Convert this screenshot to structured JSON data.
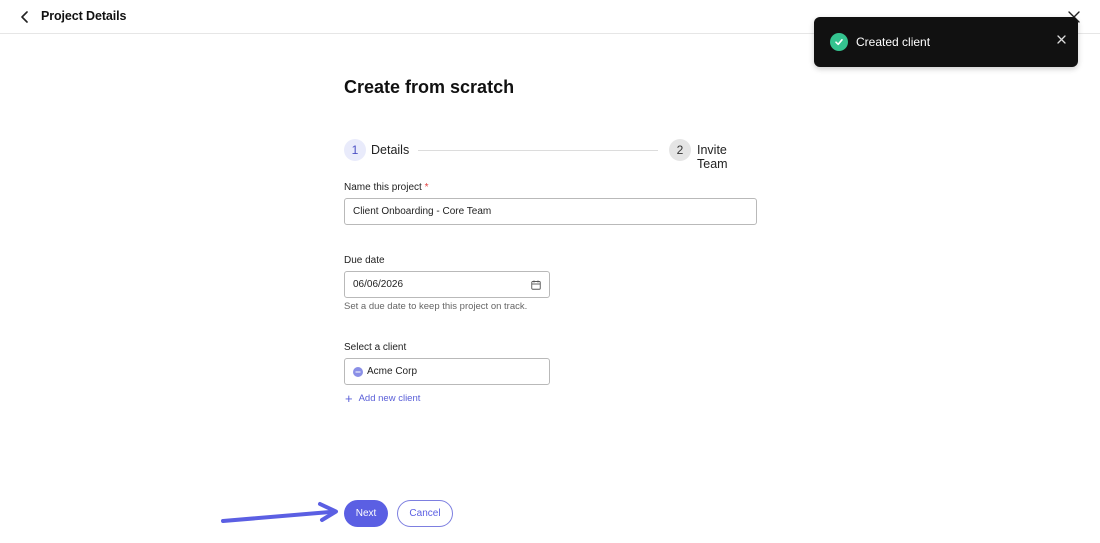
{
  "header": {
    "title": "Project Details",
    "back_icon": "chevron-left-icon",
    "close_icon": "close-icon"
  },
  "toast": {
    "message": "Created client",
    "icon": "check-circle-icon",
    "icon_color": "#34c38f"
  },
  "main": {
    "heading": "Create from scratch",
    "steps": [
      {
        "number": "1",
        "label": "Details"
      },
      {
        "number": "2",
        "label": "Invite Team"
      }
    ],
    "project_name": {
      "label": "Name this project",
      "required_marker": "*",
      "value": "Client Onboarding - Core Team"
    },
    "due_date": {
      "label": "Due date",
      "value": "06/06/2026",
      "helper": "Set a due date to keep this project on track."
    },
    "client": {
      "label": "Select a client",
      "value": "Acme Corp"
    },
    "add_client_label": "Add new client"
  },
  "actions": {
    "next_label": "Next",
    "cancel_label": "Cancel"
  },
  "colors": {
    "accent": "#5b5fe3",
    "toast_bg": "#111111"
  }
}
